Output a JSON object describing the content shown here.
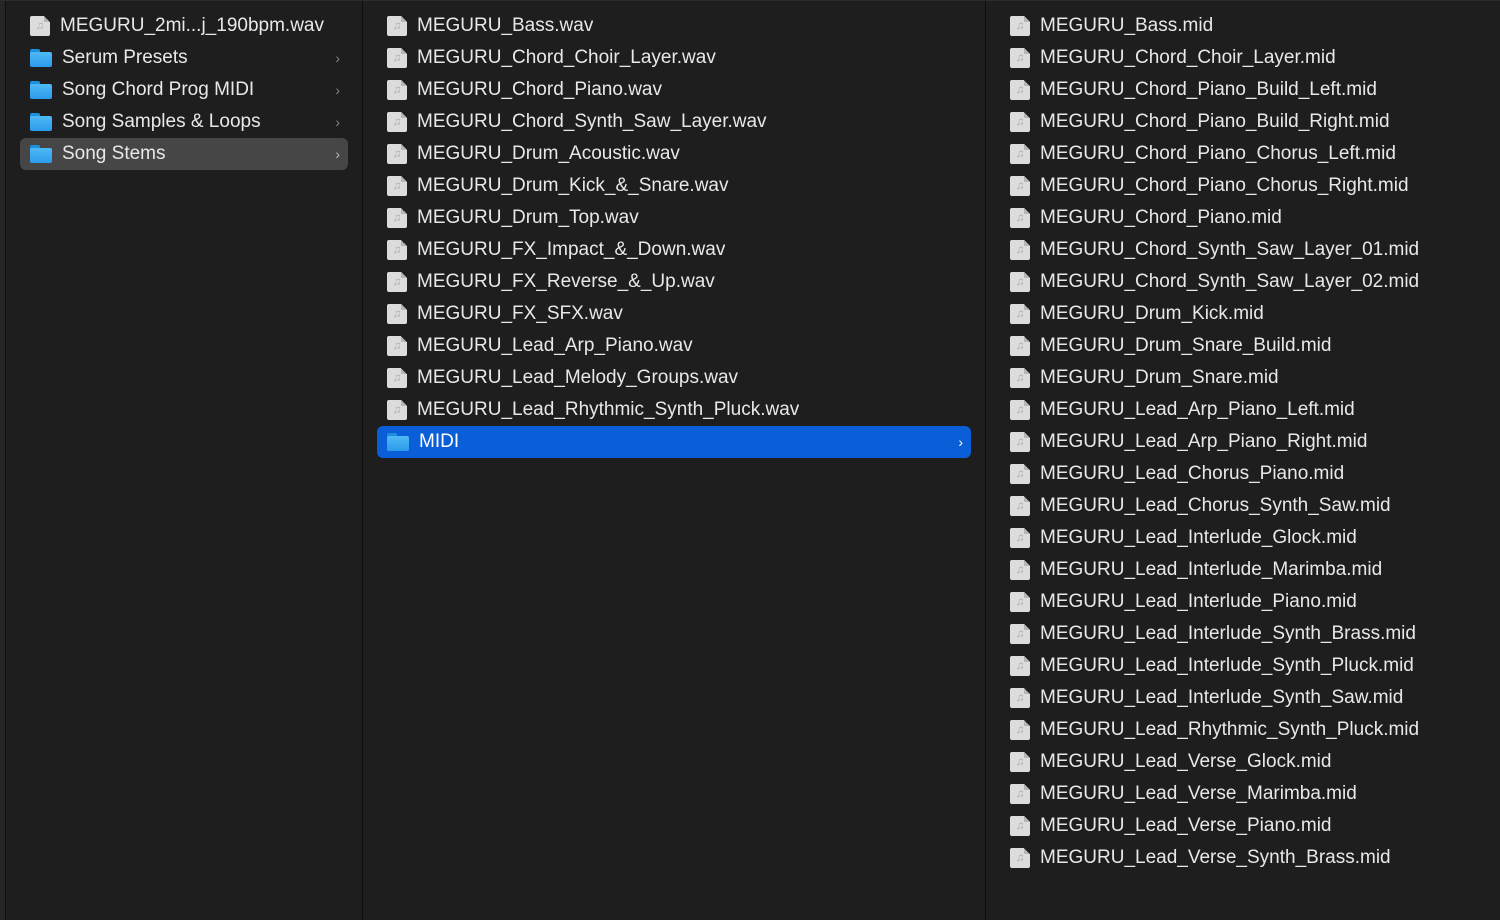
{
  "columns": [
    {
      "items": [
        {
          "type": "file",
          "label": "MEGURU_2mi...j_190bpm.wav"
        },
        {
          "type": "folder",
          "label": "Serum Presets"
        },
        {
          "type": "folder",
          "label": "Song Chord Prog MIDI"
        },
        {
          "type": "folder",
          "label": "Song Samples & Loops"
        },
        {
          "type": "folder",
          "label": "Song Stems",
          "selected": "inactive"
        }
      ]
    },
    {
      "items": [
        {
          "type": "file",
          "label": "MEGURU_Bass.wav"
        },
        {
          "type": "file",
          "label": "MEGURU_Chord_Choir_Layer.wav"
        },
        {
          "type": "file",
          "label": "MEGURU_Chord_Piano.wav"
        },
        {
          "type": "file",
          "label": "MEGURU_Chord_Synth_Saw_Layer.wav"
        },
        {
          "type": "file",
          "label": "MEGURU_Drum_Acoustic.wav"
        },
        {
          "type": "file",
          "label": "MEGURU_Drum_Kick_&_Snare.wav"
        },
        {
          "type": "file",
          "label": "MEGURU_Drum_Top.wav"
        },
        {
          "type": "file",
          "label": "MEGURU_FX_Impact_&_Down.wav"
        },
        {
          "type": "file",
          "label": "MEGURU_FX_Reverse_&_Up.wav"
        },
        {
          "type": "file",
          "label": "MEGURU_FX_SFX.wav"
        },
        {
          "type": "file",
          "label": "MEGURU_Lead_Arp_Piano.wav"
        },
        {
          "type": "file",
          "label": "MEGURU_Lead_Melody_Groups.wav"
        },
        {
          "type": "file",
          "label": "MEGURU_Lead_Rhythmic_Synth_Pluck.wav"
        },
        {
          "type": "folder",
          "label": "MIDI",
          "selected": "active"
        }
      ]
    },
    {
      "items": [
        {
          "type": "file",
          "label": "MEGURU_Bass.mid"
        },
        {
          "type": "file",
          "label": "MEGURU_Chord_Choir_Layer.mid"
        },
        {
          "type": "file",
          "label": "MEGURU_Chord_Piano_Build_Left.mid"
        },
        {
          "type": "file",
          "label": "MEGURU_Chord_Piano_Build_Right.mid"
        },
        {
          "type": "file",
          "label": "MEGURU_Chord_Piano_Chorus_Left.mid"
        },
        {
          "type": "file",
          "label": "MEGURU_Chord_Piano_Chorus_Right.mid"
        },
        {
          "type": "file",
          "label": "MEGURU_Chord_Piano.mid"
        },
        {
          "type": "file",
          "label": "MEGURU_Chord_Synth_Saw_Layer_01.mid"
        },
        {
          "type": "file",
          "label": "MEGURU_Chord_Synth_Saw_Layer_02.mid"
        },
        {
          "type": "file",
          "label": "MEGURU_Drum_Kick.mid"
        },
        {
          "type": "file",
          "label": "MEGURU_Drum_Snare_Build.mid"
        },
        {
          "type": "file",
          "label": "MEGURU_Drum_Snare.mid"
        },
        {
          "type": "file",
          "label": "MEGURU_Lead_Arp_Piano_Left.mid"
        },
        {
          "type": "file",
          "label": "MEGURU_Lead_Arp_Piano_Right.mid"
        },
        {
          "type": "file",
          "label": "MEGURU_Lead_Chorus_Piano.mid"
        },
        {
          "type": "file",
          "label": "MEGURU_Lead_Chorus_Synth_Saw.mid"
        },
        {
          "type": "file",
          "label": "MEGURU_Lead_Interlude_Glock.mid"
        },
        {
          "type": "file",
          "label": "MEGURU_Lead_Interlude_Marimba.mid"
        },
        {
          "type": "file",
          "label": "MEGURU_Lead_Interlude_Piano.mid"
        },
        {
          "type": "file",
          "label": "MEGURU_Lead_Interlude_Synth_Brass.mid"
        },
        {
          "type": "file",
          "label": "MEGURU_Lead_Interlude_Synth_Pluck.mid"
        },
        {
          "type": "file",
          "label": "MEGURU_Lead_Interlude_Synth_Saw.mid"
        },
        {
          "type": "file",
          "label": "MEGURU_Lead_Rhythmic_Synth_Pluck.mid"
        },
        {
          "type": "file",
          "label": "MEGURU_Lead_Verse_Glock.mid"
        },
        {
          "type": "file",
          "label": "MEGURU_Lead_Verse_Marimba.mid"
        },
        {
          "type": "file",
          "label": "MEGURU_Lead_Verse_Piano.mid"
        },
        {
          "type": "file",
          "label": "MEGURU_Lead_Verse_Synth_Brass.mid"
        }
      ]
    }
  ],
  "icons": {
    "file": "audio-file-icon",
    "folder": "folder-icon",
    "chevron": "chevron-right-icon"
  },
  "colors": {
    "background": "#1e1e1e",
    "selection_active": "#0a5fd8",
    "selection_inactive": "#464646",
    "folder": "#2b9cea"
  }
}
